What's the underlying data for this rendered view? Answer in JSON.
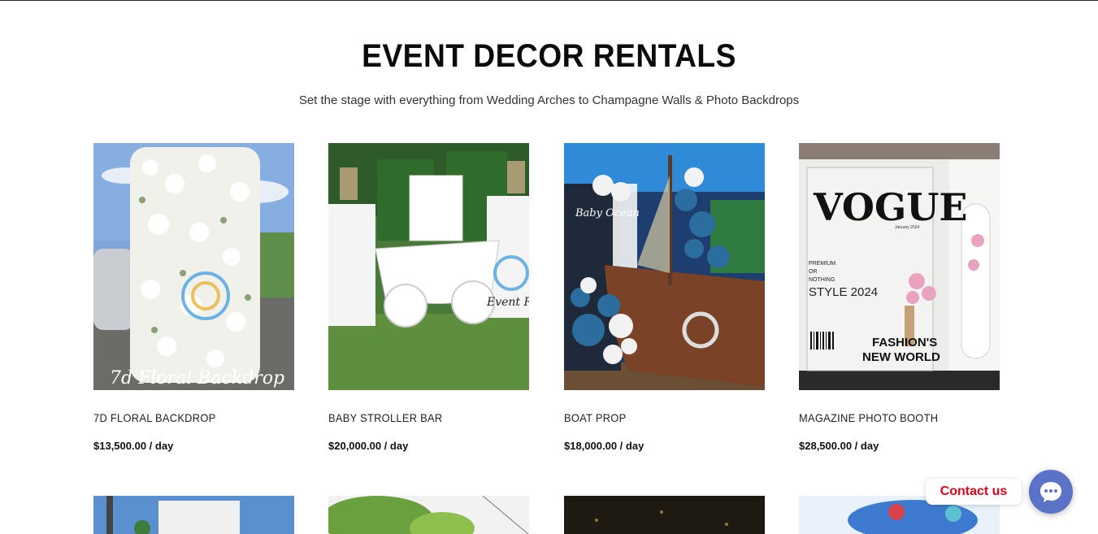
{
  "header": {
    "title": "EVENT DECOR RENTALS",
    "subtitle": "Set the stage with everything from Wedding Arches to Champagne Walls & Photo Backdrops"
  },
  "products": [
    {
      "name": "7D FLORAL BACKDROP",
      "price": "$13,500.00 / day",
      "image_caption": "7d Floral Backdrop"
    },
    {
      "name": "BABY STROLLER BAR",
      "price": "$20,000.00 / day",
      "image_caption": "Event Re"
    },
    {
      "name": "BOAT PROP",
      "price": "$18,000.00 / day",
      "image_caption": "Baby Ocean"
    },
    {
      "name": "MAGAZINE PHOTO BOOTH",
      "price": "$28,500.00 / day",
      "image_caption": "VOGUE"
    }
  ],
  "magazine_cover": {
    "masthead": "VOGUE",
    "date": "January 2024",
    "line1": "PREMIUM",
    "line2": "OR",
    "line3": "NOTHING",
    "line4": "STYLE 2024",
    "line5": "FASHION'S",
    "line6": "NEW WORLD"
  },
  "contact": {
    "label": "Contact us",
    "icon": "chat-bubble-icon"
  },
  "colors": {
    "accent_red": "#e3001b",
    "fab_blue": "#5b73c6"
  }
}
